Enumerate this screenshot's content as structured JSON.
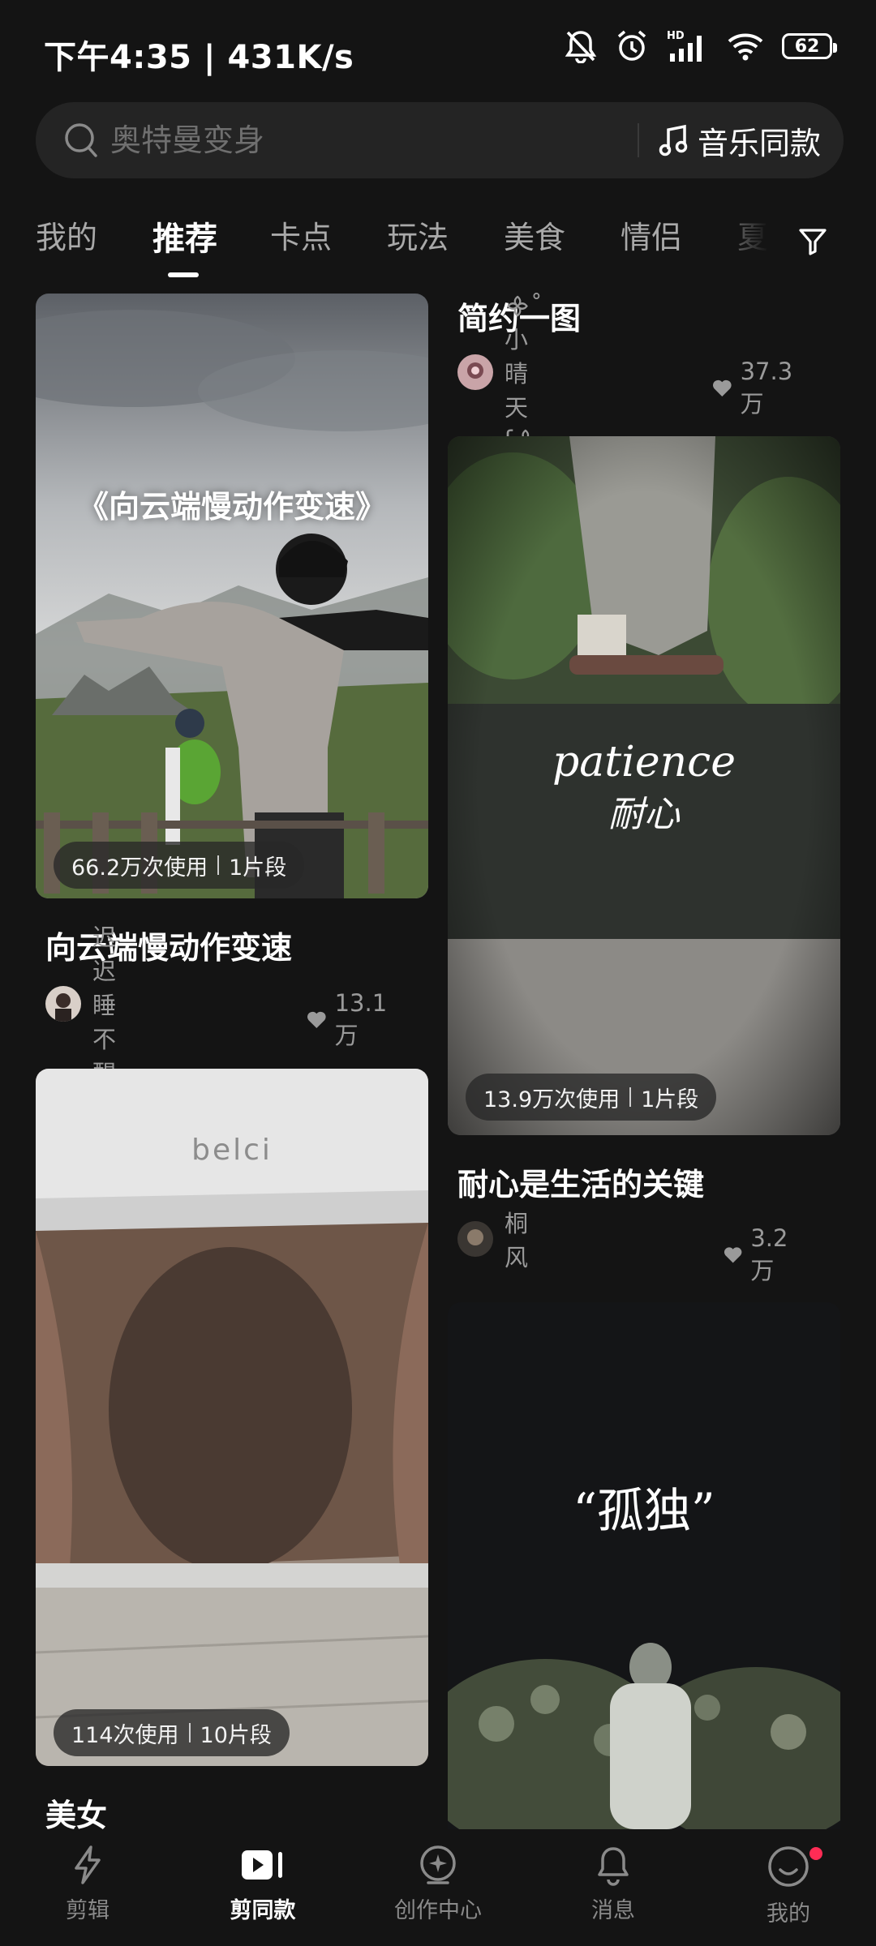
{
  "status_bar": {
    "time_speed": "下午4:35 | 431K/s",
    "hd_label": "HD",
    "battery": "62",
    "icons": [
      "mute-bell-icon",
      "alarm-icon",
      "signal-icon",
      "wifi-icon",
      "battery-icon"
    ]
  },
  "search": {
    "placeholder": "奥特曼变身",
    "music_same_label": "音乐同款"
  },
  "tabs": [
    {
      "label": "我的",
      "active": false
    },
    {
      "label": "推荐",
      "active": true
    },
    {
      "label": "卡点",
      "active": false
    },
    {
      "label": "玩法",
      "active": false
    },
    {
      "label": "美食",
      "active": false
    },
    {
      "label": "情侣",
      "active": false
    },
    {
      "label": "夏日",
      "active": false
    }
  ],
  "feed": {
    "left": [
      {
        "image_text": "《向云端慢动作变速》",
        "usage": "66.2万次使用",
        "segments": "1片段",
        "title": "向云端慢动作变速",
        "author": "迟迟睡不醒",
        "likes": "13.1万"
      },
      {
        "image_text": "belci",
        "usage": "114次使用",
        "segments": "10片段",
        "title": "美女"
      }
    ],
    "right": [
      {
        "title": "简约一图",
        "author": "᯽˚小晴天ʃ᯽",
        "likes": "37.3万"
      },
      {
        "image_text_en": "patience",
        "image_text_cn": "耐心",
        "usage": "13.9万次使用",
        "segments": "1片段",
        "title": "耐心是生活的关键",
        "author": "桐风",
        "likes": "3.2万"
      },
      {
        "image_text": "“孤独”"
      }
    ]
  },
  "bottom_nav": [
    {
      "label": "剪辑",
      "icon": "lightning-icon",
      "active": false
    },
    {
      "label": "剪同款",
      "icon": "template-play-icon",
      "active": true
    },
    {
      "label": "创作中心",
      "icon": "create-center-icon",
      "active": false
    },
    {
      "label": "消息",
      "icon": "bell-icon",
      "active": false
    },
    {
      "label": "我的",
      "icon": "smile-profile-icon",
      "active": false,
      "badge": true
    }
  ],
  "colors": {
    "background": "#141414",
    "search_bg": "#242424",
    "badge": "#ff2c55",
    "muted_text": "#9a9a9a"
  }
}
